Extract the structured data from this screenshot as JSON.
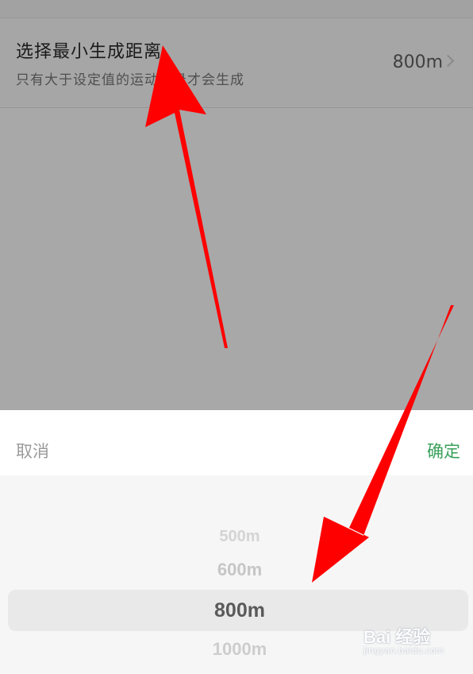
{
  "setting": {
    "title": "选择最小生成距离",
    "subtitle": "只有大于设定值的运动记录才会生成",
    "value": "800m"
  },
  "sheet": {
    "cancel_label": "取消",
    "confirm_label": "确定"
  },
  "picker": {
    "options": [
      "500m",
      "600m",
      "800m",
      "1000m"
    ],
    "selected": "800m"
  },
  "watermark": {
    "logo": "Bai 经验",
    "url": "jingyan.baidu.com"
  },
  "colors": {
    "confirm": "#3aa05a",
    "annotation_arrow": "#ff0000"
  },
  "icons": [
    "chevron-right-icon",
    "baidu-paw-icon"
  ]
}
